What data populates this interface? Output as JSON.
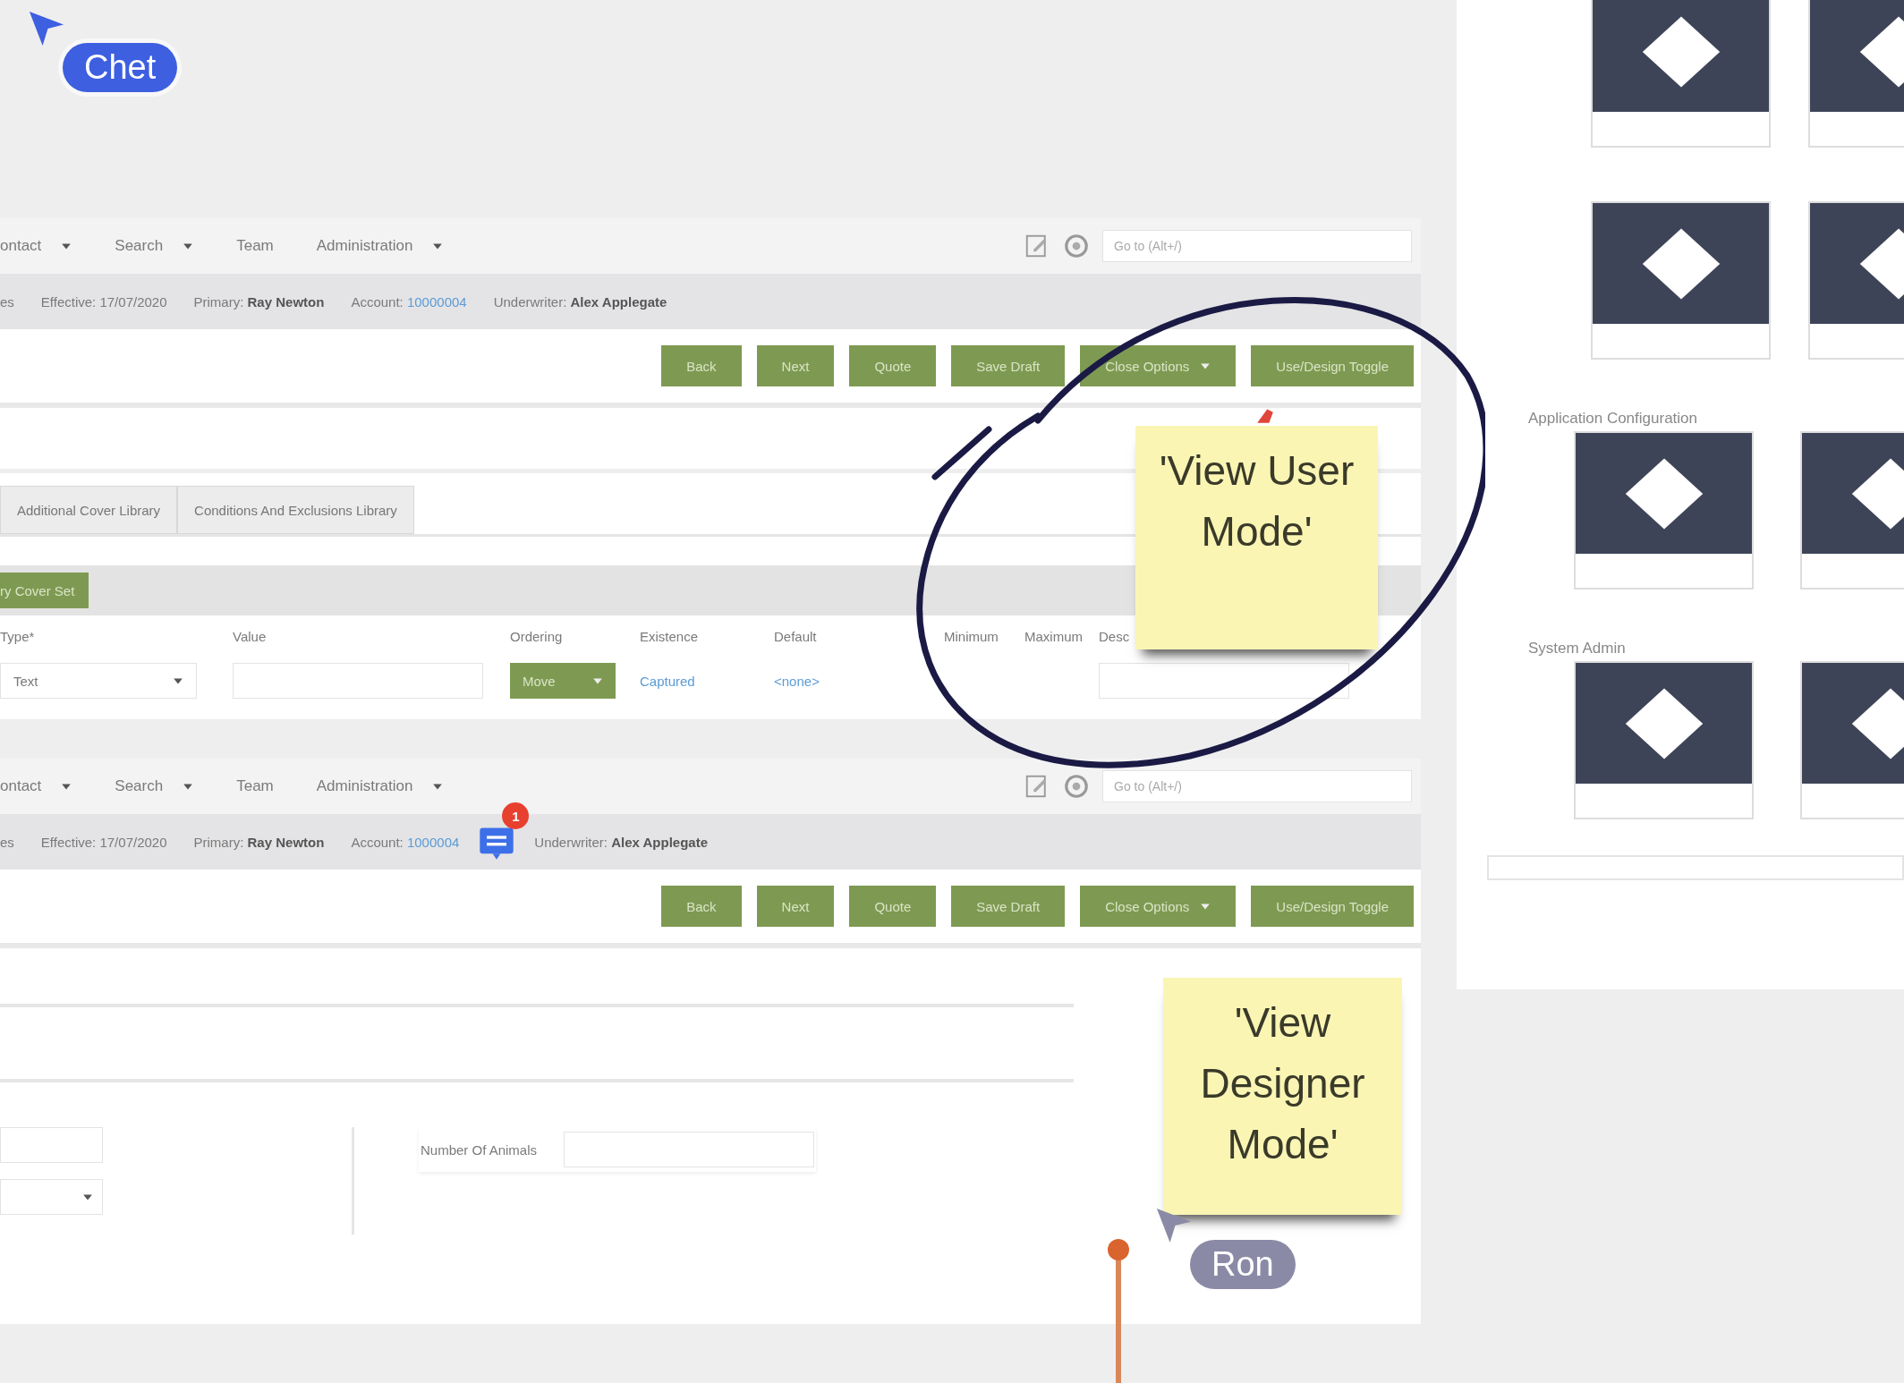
{
  "cursors": [
    {
      "name": "Chet",
      "color": "#3d5fe0"
    },
    {
      "name": "Ron",
      "color": "#8b8aa6"
    }
  ],
  "sticky_notes": [
    {
      "text": "'View User Mode'"
    },
    {
      "text": "'View Designer Mode'"
    }
  ],
  "screenshots": [
    {
      "nav": [
        {
          "label": "ontact",
          "dropdown": true
        },
        {
          "label": "Search",
          "dropdown": true
        },
        {
          "label": "Team",
          "dropdown": false
        },
        {
          "label": "Administration",
          "dropdown": true
        }
      ],
      "goto_placeholder": "Go to (Alt+/)",
      "info": [
        {
          "kind": "text",
          "text": "es"
        },
        {
          "kind": "text",
          "text": "Effective: 17/07/2020"
        },
        {
          "kind": "text",
          "text": "Primary: **Ray Newton**"
        },
        {
          "kind": "link",
          "label": "Account:",
          "text": "10000004"
        },
        {
          "kind": "text",
          "text": "Underwriter: **Alex Applegate**"
        }
      ],
      "buttons": [
        {
          "label": "Back",
          "dropdown": false
        },
        {
          "label": "Next",
          "dropdown": false
        },
        {
          "label": "Quote",
          "dropdown": false
        },
        {
          "label": "Save Draft",
          "dropdown": false
        },
        {
          "label": "Close Options",
          "dropdown": true
        },
        {
          "label": "Use/Design Toggle",
          "dropdown": false
        }
      ],
      "tabs": [
        {
          "label": "Additional Cover Library",
          "selected": false
        },
        {
          "label": "Conditions And Exclusions Library",
          "selected": false
        }
      ],
      "bar_button": "ry Cover Set",
      "table": {
        "columns": [
          "Type*",
          "Value",
          "Ordering",
          "Existence",
          "Default",
          "Minimum",
          "Maximum",
          "Desc"
        ],
        "row": {
          "type": "Text",
          "ordering": "Move",
          "existence": "Captured",
          "default": "<none>"
        }
      }
    },
    {
      "nav": [
        {
          "label": "ontact",
          "dropdown": true
        },
        {
          "label": "Search",
          "dropdown": true
        },
        {
          "label": "Team",
          "dropdown": false
        },
        {
          "label": "Administration",
          "dropdown": true
        }
      ],
      "goto_placeholder": "Go to (Alt+/)",
      "info": [
        {
          "kind": "text",
          "text": "es"
        },
        {
          "kind": "text",
          "text": "Effective: 17/07/2020"
        },
        {
          "kind": "text",
          "text": "Primary: **Ray Newton**"
        },
        {
          "kind": "link",
          "label": "Account:",
          "text": "1000004"
        },
        {
          "kind": "text",
          "text": "Underwriter: **Alex Applegate**"
        }
      ],
      "comment_badge": "1",
      "buttons": [
        {
          "label": "Back",
          "dropdown": false
        },
        {
          "label": "Next",
          "dropdown": false
        },
        {
          "label": "Quote",
          "dropdown": false
        },
        {
          "label": "Save Draft",
          "dropdown": false
        },
        {
          "label": "Close Options",
          "dropdown": true
        },
        {
          "label": "Use/Design Toggle",
          "dropdown": false
        }
      ],
      "form": {
        "field_label": "Number Of Animals"
      }
    }
  ],
  "side_panel": {
    "section_titles": [
      "Application Configuration",
      "System Admin"
    ]
  }
}
